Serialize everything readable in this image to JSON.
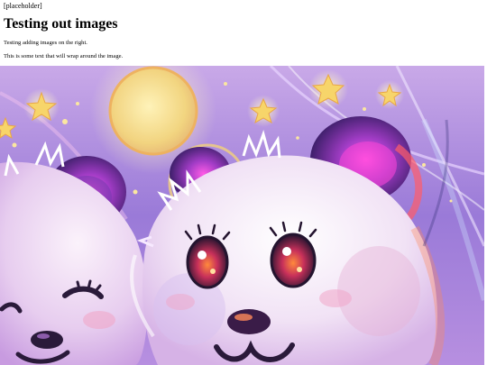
{
  "page": {
    "placeholder": "[placeholder]",
    "title": "Testing out images",
    "paragraphs": [
      "Testing adding images on the right.",
      "This is some text that will wrap around the image."
    ]
  },
  "image": {
    "subject": "illustration-two-bears-night-sky",
    "palette": {
      "sky_top": "#b59be0",
      "sky_mid": "#8a6fd8",
      "moon": "#f6dc86",
      "fur": "#f3eaf6",
      "fur_shadow": "#d9b8ea",
      "ear": "#5a2f8a",
      "ear_glow": "#e64fd6",
      "eye": "#2a1a3a",
      "blush": "#f0a6c8",
      "star": "#f7d56a"
    }
  }
}
